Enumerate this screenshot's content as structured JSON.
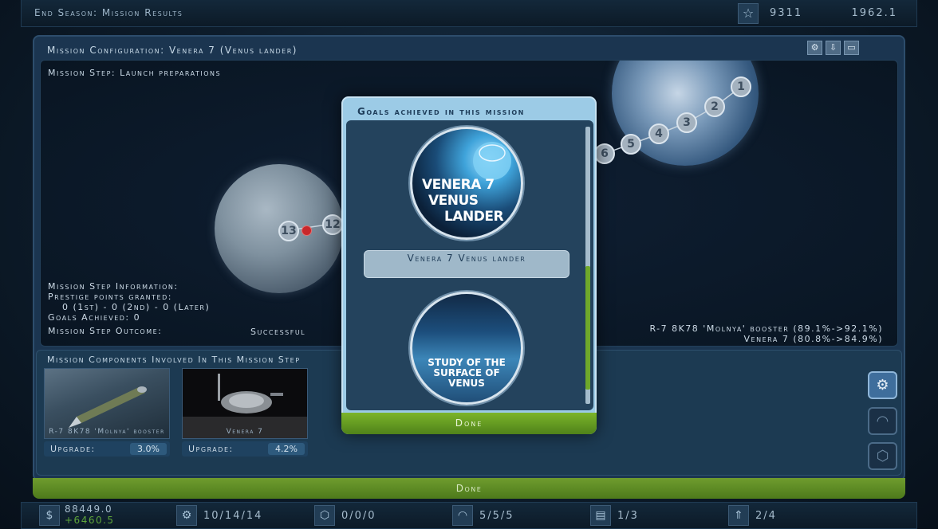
{
  "topbar": {
    "title": "End Season:   Mission Results",
    "reputation": "9311",
    "date": "1962.1"
  },
  "panel": {
    "title": "Mission Configuration: Venera 7 (Venus lander)"
  },
  "space": {
    "step_title": "Mission Step: Launch preparations",
    "nodes": [
      "1",
      "2",
      "3",
      "4",
      "5",
      "6",
      "12",
      "13"
    ],
    "info": {
      "heading": "Mission Step Information:",
      "prestige_label": "Prestige points granted:",
      "prestige_value": "0 (1st) - 0 (2nd) - 0 (Later)",
      "goals_label": "Goals Achieved: 0",
      "outcome_label": "Mission Step Outcome:",
      "outcome_value": "Successful"
    },
    "boosters": [
      "R-7 8K78 'Molnya' booster (89.1%->92.1%)",
      "Venera 7 (80.8%->84.9%)"
    ]
  },
  "components": {
    "heading": "Mission Components Involved In This Mission Step",
    "items": [
      {
        "caption": "R-7 8K78 'Molnya' booster",
        "upgrade_label": "Upgrade:",
        "upgrade_value": "3.0%"
      },
      {
        "caption": "Venera 7",
        "upgrade_label": "Upgrade:",
        "upgrade_value": "4.2%"
      }
    ]
  },
  "done_label": "Done",
  "bottombar": {
    "money": "88449.0",
    "money_delta": "+6460.5",
    "vehicles": "10/14/14",
    "capsules": "0/0/0",
    "crew": "5/5/5",
    "facilities": "1/3",
    "rockets": "2/4"
  },
  "modal": {
    "title": "Goals achieved in this mission",
    "patch1": [
      "VENERA 7",
      "VENUS",
      "LANDER"
    ],
    "goal1_label": "Venera 7 Venus lander",
    "patch2": [
      "STUDY OF THE",
      "SURFACE OF",
      "VENUS"
    ],
    "done_label": "Done"
  },
  "colors": {
    "accent_green": "#6fa82b",
    "panel_blue": "#1b3550",
    "modal_blue": "#9ccbe6",
    "marker_red": "#c8272b"
  }
}
